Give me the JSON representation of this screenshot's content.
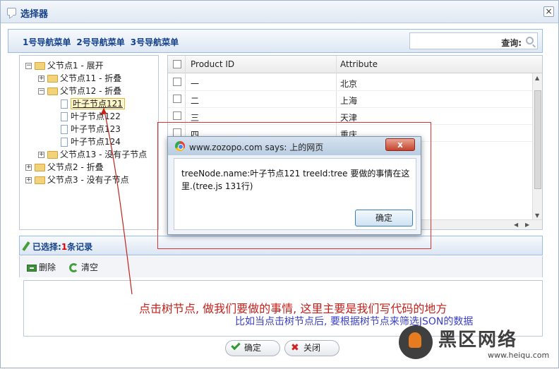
{
  "window": {
    "title": "选择器"
  },
  "menubar": {
    "items": [
      "1号导航菜单",
      "2号导航菜单",
      "3号导航菜单"
    ],
    "search_label": "查询:"
  },
  "tree": {
    "nodes": [
      {
        "label": "父节点1 - 展开",
        "toggle": "−"
      },
      {
        "label": "父节点11 - 折叠",
        "toggle": "+"
      },
      {
        "label": "父节点12 - 折叠",
        "toggle": "−"
      },
      {
        "label": "叶子节点121"
      },
      {
        "label": "叶子节点122"
      },
      {
        "label": "叶子节点123"
      },
      {
        "label": "叶子节点124"
      },
      {
        "label": "父节点13 - 没有子节点",
        "toggle": "+"
      },
      {
        "label": "父节点2 - 折叠",
        "toggle": "+"
      },
      {
        "label": "父节点3 - 没有子节点",
        "toggle": "+"
      }
    ]
  },
  "grid": {
    "columns": [
      "Product ID",
      "Attribute"
    ],
    "rows": [
      {
        "id": "一",
        "attr": "北京"
      },
      {
        "id": "二",
        "attr": "上海"
      },
      {
        "id": "三",
        "attr": "天津"
      },
      {
        "id": "四",
        "attr": "重庆"
      }
    ]
  },
  "selected": {
    "prefix": "已选择:",
    "count": "1",
    "suffix": "条记录"
  },
  "toolbar": {
    "delete_label": "删除",
    "clear_label": "清空"
  },
  "buttons": {
    "ok_label": "确定",
    "close_label": "关闭"
  },
  "dialog": {
    "title": "www.zozopo.com says: 上的网页",
    "close_symbol": "x",
    "message": "treeNode.name:叶子节点121 treeId:tree 要做的事情在这里.(tree.js 131行)",
    "ok_label": "确定"
  },
  "annotations": {
    "red_note": "点击树节点, 做我们要做的事情, 这里主要是我们写代码的地方",
    "blue_note": "比如当点击树节点后, 要根据树节点来筛选JSON的数据"
  },
  "watermark": {
    "brand": "黑区网络",
    "url": "www.heiqu.com"
  },
  "colors": {
    "accent": "#15428b",
    "annotation_red": "#c3221c",
    "annotation_blue": "#3a40c6"
  }
}
